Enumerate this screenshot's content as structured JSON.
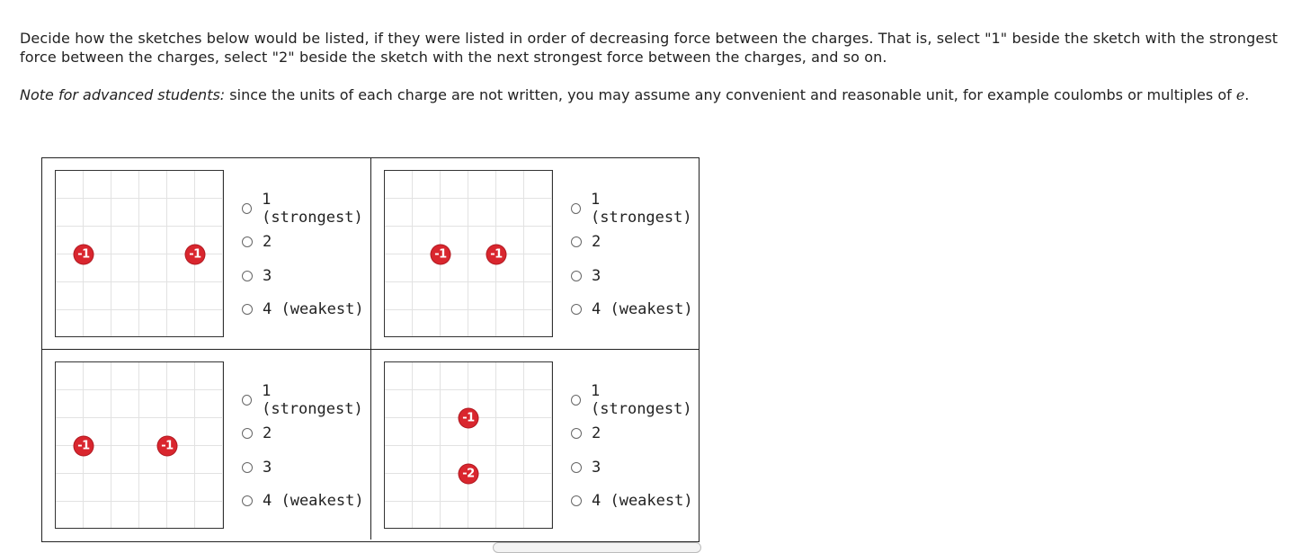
{
  "instructions": "Decide how the sketches below would be listed, if they were listed in order of decreasing force between the charges. That is, select \"1\" beside the sketch with the strongest force between the charges, select \"2\" beside the sketch with the next strongest force between the charges, and so on.",
  "note": {
    "label": "Note for advanced students:",
    "text": " since the units of each charge are not written, you may assume any convenient and reasonable unit, for example coulombs or multiples of ",
    "symbol": "e",
    "end": "."
  },
  "options": [
    "1 (strongest)",
    "2",
    "3",
    "4 (weakest)"
  ],
  "sketches": [
    {
      "charges": [
        "-1",
        "-1"
      ]
    },
    {
      "charges": [
        "-1",
        "-1"
      ]
    },
    {
      "charges": [
        "-1",
        "-1"
      ]
    },
    {
      "charges": [
        "-1",
        "-2"
      ]
    }
  ],
  "colors": {
    "charge": "#d9262e",
    "border": "#222222",
    "grid": "#e2e2e2"
  }
}
